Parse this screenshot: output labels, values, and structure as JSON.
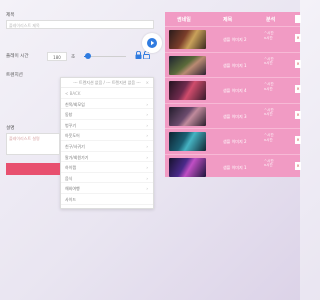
{
  "form": {
    "title_label": "제목",
    "title_placeholder": "플레이리스트 제목",
    "play_time_label": "플레이 시간",
    "play_time_value": "180",
    "play_time_unit": "초",
    "category_label": "트렌지션",
    "description_label": "설명",
    "description_placeholder": "플레이리스트 설명"
  },
  "dropdown": {
    "search_placeholder": "--- 트렌지션 없음 / --- 트렌지션 없음 ---",
    "clear": "×",
    "back": "< BACK",
    "items": [
      "친목/회모임",
      "동창",
      "벙꾸기",
      "아웃도어",
      "친구/사귀기",
      "말가/회원가기",
      "하이캠",
      "음식",
      "해외여행",
      "사이드"
    ]
  },
  "table": {
    "col_thumb": "썸네일",
    "col_name": "제목",
    "col_time": "분석",
    "rows": [
      {
        "name": "샘플 이미지 2",
        "time_up": "^시간",
        "time_down": "v시간"
      },
      {
        "name": "샘플 이미지 1",
        "time_up": "^시간",
        "time_down": "v시간"
      },
      {
        "name": "샘플 이미지 4",
        "time_up": "^시간",
        "time_down": "v시간"
      },
      {
        "name": "샘플 이미지 3",
        "time_up": "^시간",
        "time_down": "v시간"
      },
      {
        "name": "샘플 이미지 2",
        "time_up": "^시간",
        "time_down": "v시간"
      },
      {
        "name": "샘플 이미지 1",
        "time_up": "^시간",
        "time_down": "v시간"
      }
    ]
  },
  "colors": {
    "accent": "#f19bc4",
    "button": "#e8506f",
    "play": "#2f7be0"
  },
  "icons": {
    "play": "play-icon",
    "lock": "lock-icon",
    "delete": "delete-icon",
    "chevron": "chevron-right-icon"
  }
}
